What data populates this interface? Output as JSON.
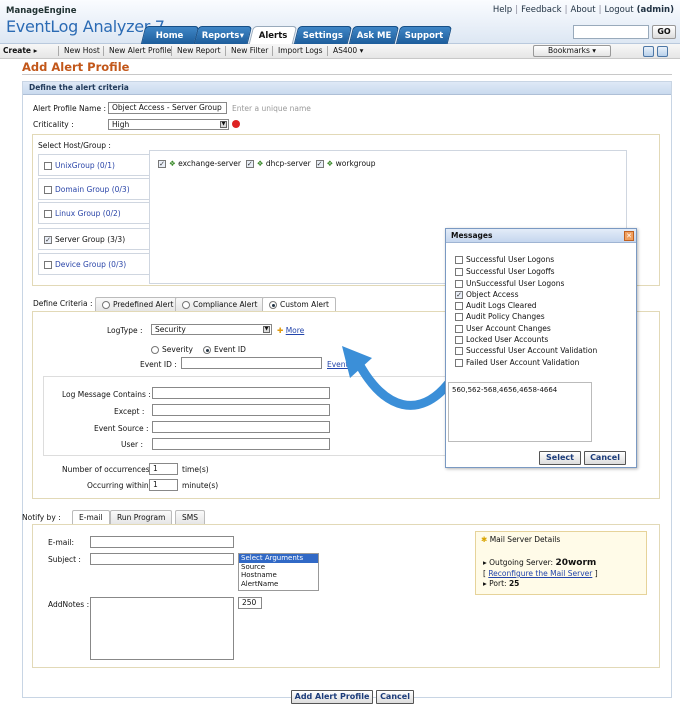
{
  "header": {
    "brand_small": "ManageEngine",
    "brand_big": "EventLog Analyzer 7",
    "links": [
      "Help",
      "Feedback",
      "About",
      "Logout"
    ],
    "user": "(admin)",
    "go_label": "GO",
    "tabs": [
      "Home",
      "Reports",
      "Alerts",
      "Settings",
      "Ask ME",
      "Support"
    ],
    "active_tab": "Alerts"
  },
  "toolbar": {
    "items": [
      "Create",
      "New Host",
      "New Alert Profile",
      "New Report",
      "New Filter",
      "Import Logs",
      "AS400"
    ],
    "bookmarks": "Bookmarks"
  },
  "page_title": "Add Alert Profile",
  "criteria": {
    "section_title": "Define the alert criteria",
    "profile_name_label": "Alert Profile Name :",
    "profile_name_value": "Object Access - Server Group",
    "profile_name_hint": "Enter a unique name",
    "criticality_label": "Criticality :",
    "criticality_value": "High",
    "host_group_label": "Select Host/Group :",
    "groups": [
      "UnixGroup (0/1)",
      "Domain Group (0/3)",
      "Linux Group (0/2)",
      "Server Group (3/3)",
      "Device Group (0/3)"
    ],
    "hosts": [
      "exchange-server",
      "dhcp-server",
      "workgroup"
    ]
  },
  "define": {
    "label": "Define Criteria :",
    "tabs": [
      "Predefined Alert",
      "Compliance Alert",
      "Custom Alert"
    ],
    "logtype_label": "LogType :",
    "logtype_value": "Security",
    "more_label": "More",
    "radio_severity": "Severity",
    "radio_eventid": "Event ID",
    "eventid_label": "Event ID :",
    "eventid_link": "Event ID",
    "log_contains_label": "Log Message Contains :",
    "except_label": "Except :",
    "source_label": "Event Source :",
    "user_label": "User :",
    "occurrences_label": "Number of occurrences :",
    "occurrences_value": "1",
    "occurrences_unit": "time(s)",
    "within_label": "Occurring within :",
    "within_value": "1",
    "within_unit": "minute(s)"
  },
  "popup": {
    "title": "Messages",
    "items": [
      "Successful User Logons",
      "Successful User Logoffs",
      "UnSuccessful User Logons",
      "Object Access",
      "Audit Logs Cleared",
      "Audit Policy Changes",
      "User Account Changes",
      "Locked User Accounts",
      "Successful User Account Validation",
      "Failed User Account Validation"
    ],
    "checked": "Object Access",
    "ids_value": "560,562-568,4656,4658-4664",
    "select_label": "Select",
    "cancel_label": "Cancel"
  },
  "notify": {
    "label": "Notify by :",
    "tabs": [
      "E-mail",
      "Run Program",
      "SMS"
    ],
    "email_label": "E-mail:",
    "subject_label": "Subject :",
    "addnotes_label": "AddNotes :",
    "args": [
      "Select Arguments",
      "Source",
      "Hostname",
      "AlertName"
    ],
    "char_count": "250",
    "mail_title": "Mail Server Details",
    "outgoing_label": "Outgoing Server:",
    "outgoing_value": "20worm",
    "reconfigure": "Reconfigure the Mail Server",
    "port_label": "Port:",
    "port_value": "25"
  },
  "footer": {
    "add_label": "Add Alert Profile",
    "cancel_label": "Cancel"
  }
}
